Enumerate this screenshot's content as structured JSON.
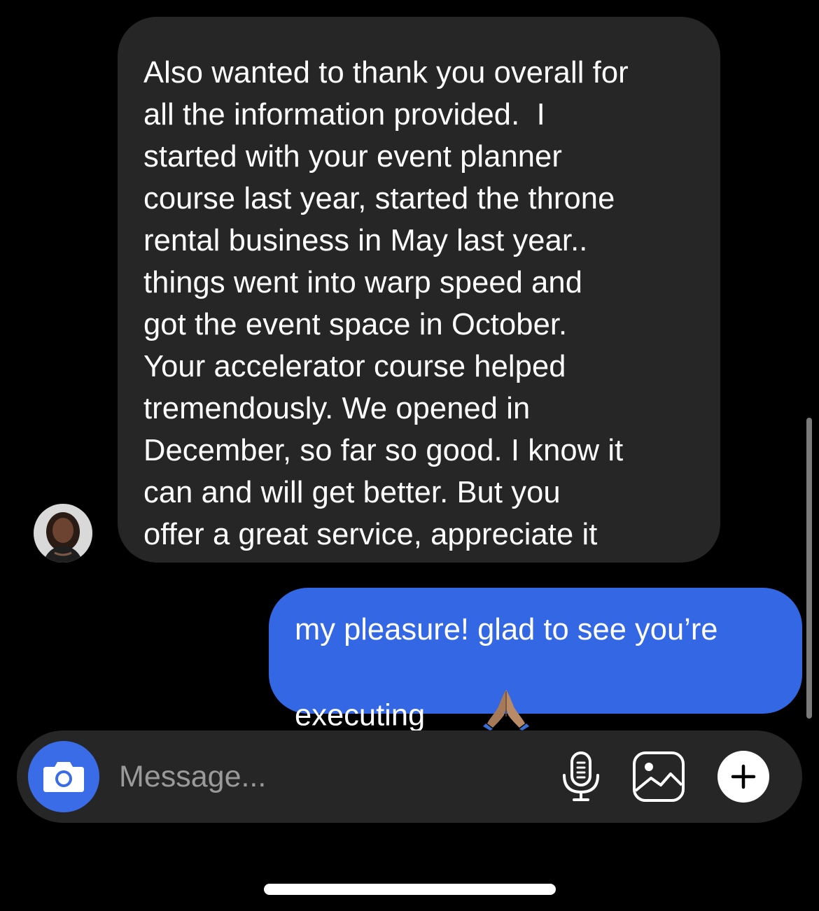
{
  "conversation": {
    "incoming_message": {
      "lines": [
        "Also wanted to thank you overall for",
        "all the information provided.  I",
        "started with your event planner",
        "course last year, started the throne",
        "rental business in May last year..",
        "things went into warp speed and",
        "got the event space in October.",
        "Your accelerator course helped",
        "tremendously. We opened in",
        "December, so far so good. I know it",
        "can and will get better. But you",
        "offer a great service, appreciate it"
      ]
    },
    "outgoing_message": {
      "lines": [
        "my pleasure! glad to see you’re",
        "executing"
      ],
      "emoji": "folded-hands-medium-skin-tone"
    }
  },
  "composer": {
    "placeholder": "Message...",
    "value": "",
    "camera_icon": "camera-icon",
    "mic_icon": "microphone-icon",
    "gallery_icon": "image-gallery-icon",
    "add_icon": "plus-icon"
  },
  "colors": {
    "background": "#000000",
    "incoming_bubble": "#262626",
    "outgoing_bubble": "#3467e3",
    "camera_button": "#3b6ce8",
    "composer_bg": "#262626"
  }
}
